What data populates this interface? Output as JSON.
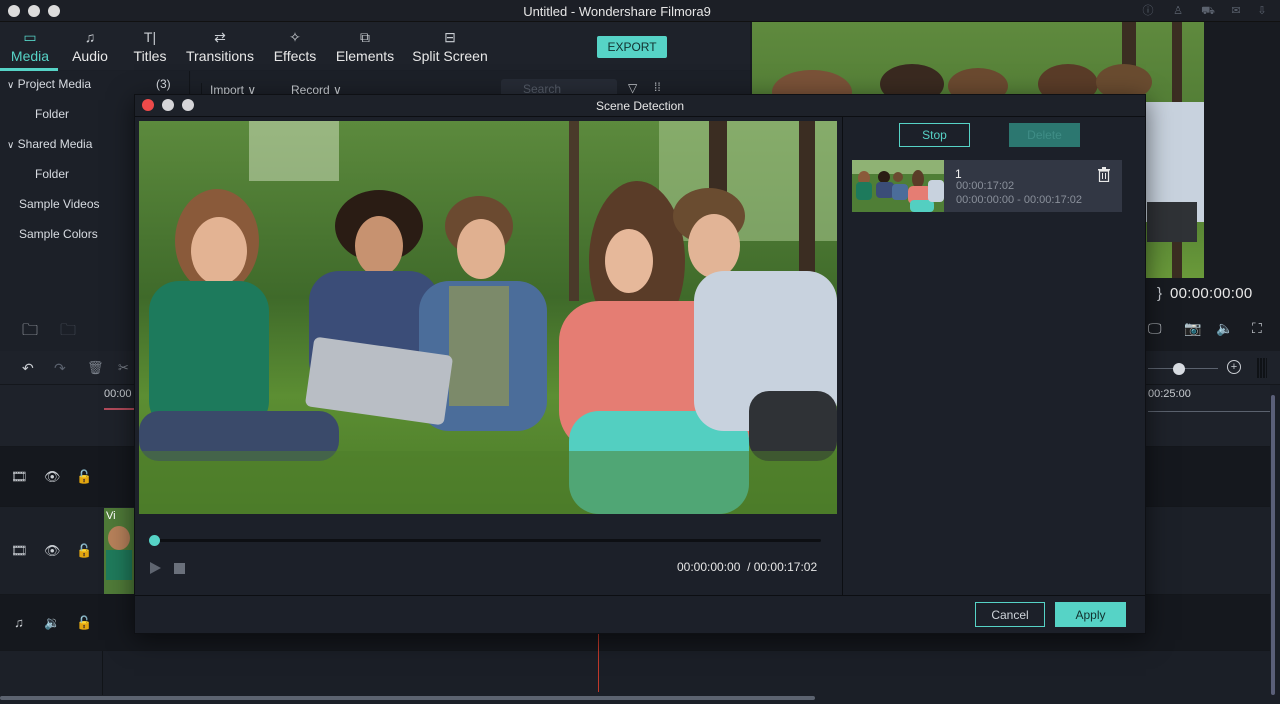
{
  "window": {
    "title": "Untitled - Wondershare Filmora9",
    "right_icons": [
      "info-icon",
      "account-icon",
      "cart-icon",
      "mail-icon",
      "download-icon"
    ]
  },
  "toolbar": {
    "tabs": [
      {
        "label": "Media",
        "icon": "folder-icon",
        "active": true
      },
      {
        "label": "Audio",
        "icon": "music-note-icon",
        "active": false
      },
      {
        "label": "Titles",
        "icon": "text-icon",
        "active": false
      },
      {
        "label": "Transitions",
        "icon": "transitions-icon",
        "active": false
      },
      {
        "label": "Effects",
        "icon": "effects-icon",
        "active": false
      },
      {
        "label": "Elements",
        "icon": "elements-icon",
        "active": false
      },
      {
        "label": "Split Screen",
        "icon": "split-screen-icon",
        "active": false
      }
    ],
    "export_label": "EXPORT",
    "accent_color": "#56d3c6"
  },
  "library": {
    "project_media": {
      "label": "Project Media",
      "count": "(3)"
    },
    "project_folder": "Folder",
    "shared_media": {
      "label": "Shared Media"
    },
    "shared_folder": "Folder",
    "sample_videos": "Sample Videos",
    "sample_colors": "Sample Colors"
  },
  "media_toolbar": {
    "import_label": "Import",
    "record_label": "Record",
    "search_placeholder": "Search"
  },
  "preview": {
    "timecode": "00:00:00:00",
    "brace": "}"
  },
  "timeline": {
    "ruler_start": "00:00",
    "ruler_end": "00:25:00",
    "clip_label": "Vi"
  },
  "dialog": {
    "title": "Scene Detection",
    "stop_label": "Stop",
    "delete_label": "Delete",
    "current_time": "00:00:00:00",
    "total_time": "/ 00:00:17:02",
    "progress": 0,
    "scenes": [
      {
        "number": "1",
        "duration": "00:00:17:02",
        "range": "00:00:00:00 - 00:00:17:02"
      }
    ],
    "cancel_label": "Cancel",
    "apply_label": "Apply"
  }
}
